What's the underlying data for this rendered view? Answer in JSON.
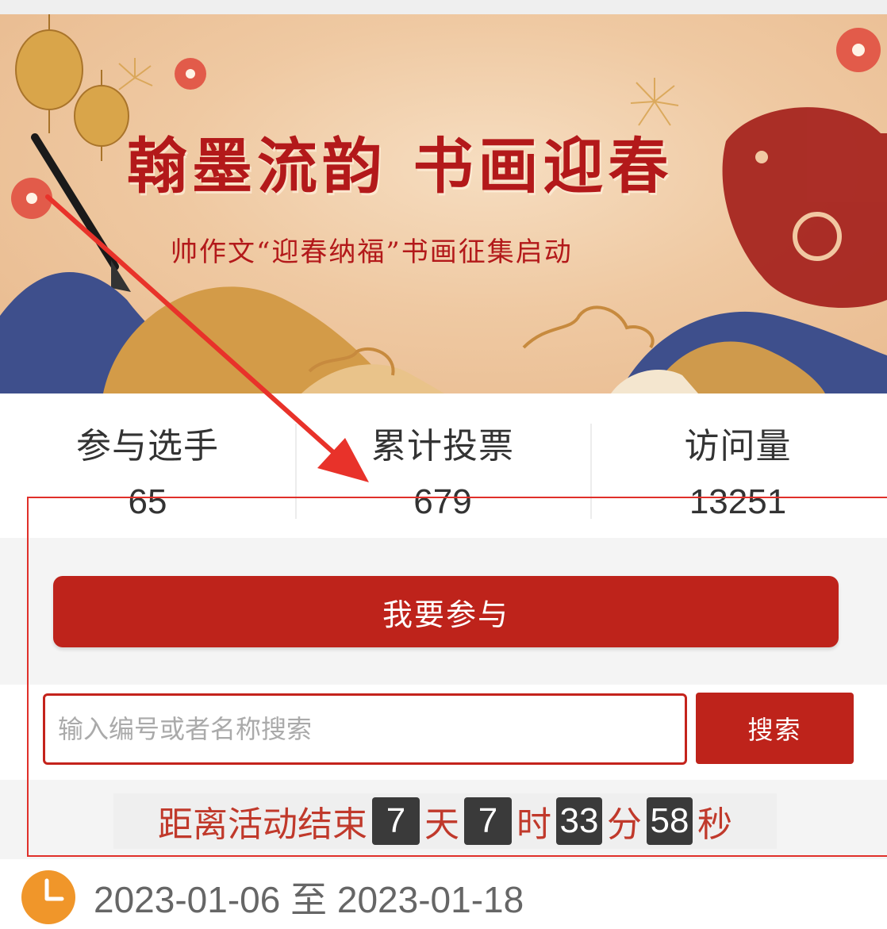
{
  "banner": {
    "title": "翰墨流韵  书画迎春",
    "subtitle": "帅作文“迎春纳福”书画征集启动"
  },
  "stats": [
    {
      "label": "参与选手",
      "value": "65"
    },
    {
      "label": "累计投票",
      "value": "679"
    },
    {
      "label": "访问量",
      "value": "13251"
    }
  ],
  "join_button": {
    "label": "我要参与"
  },
  "search": {
    "placeholder": "输入编号或者名称搜索",
    "value": "",
    "button_label": "搜索"
  },
  "countdown": {
    "prefix": "距离活动结束",
    "days": "7",
    "days_unit": "天",
    "hours": "7",
    "hours_unit": "时",
    "minutes": "33",
    "minutes_unit": "分",
    "seconds": "58",
    "seconds_unit": "秒"
  },
  "activity_period": {
    "start": "2023-01-06",
    "separator": "至",
    "end": "2023-01-18"
  },
  "colors": {
    "primary_red": "#be231b",
    "countdown_text": "#c0392b",
    "clock_icon": "#f0962a",
    "annotation": "#e0302a"
  },
  "icons": {
    "clock": "clock-icon"
  }
}
